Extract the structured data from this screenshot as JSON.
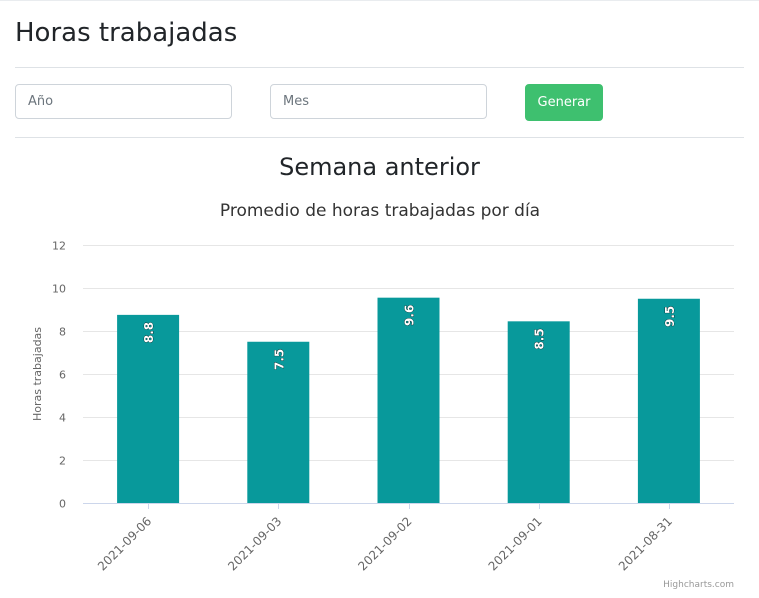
{
  "page": {
    "title": "Horas trabajadas"
  },
  "filters": {
    "year_placeholder": "Año",
    "month_placeholder": "Mes",
    "generate_label": "Generar"
  },
  "section": {
    "title": "Semana anterior"
  },
  "colors": {
    "bar": "#08999b",
    "button": "#3ec06f"
  },
  "chart_data": {
    "type": "bar",
    "title": "Promedio de horas trabajadas por día",
    "xlabel": "",
    "ylabel": "Horas trabajadas",
    "categories": [
      "2021-09-06",
      "2021-09-03",
      "2021-09-02",
      "2021-09-01",
      "2021-08-31"
    ],
    "values": [
      8.75,
      7.5,
      9.55,
      8.45,
      9.5
    ],
    "data_labels": [
      "8.8",
      "7.5",
      "9.6",
      "8.5",
      "9.5"
    ],
    "ylim": [
      0,
      12
    ],
    "yticks": [
      0,
      2,
      4,
      6,
      8,
      10,
      12
    ],
    "grid": true,
    "legend": "none",
    "credits": "Highcharts.com"
  }
}
